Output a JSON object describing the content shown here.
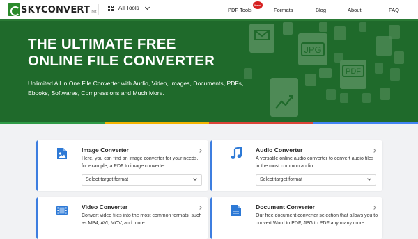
{
  "nav": {
    "logo_text": "SKYCONVERT",
    "logo_suffix": ".net",
    "all_tools": "All Tools",
    "links": [
      "PDF Tools",
      "Formats",
      "Blog",
      "About",
      "FAQ"
    ],
    "new_badge": "New!"
  },
  "hero": {
    "title_line1": "THE ULTIMATE FREE",
    "title_line2": "ONLINE FILE CONVERTER",
    "subtitle": "Unlimited All in One File Converter with Audio, Video, Images, Documents, PDFs, Ebooks, Softwares, Compressions and Much More.",
    "icon_labels": [
      "JPG",
      "PDF"
    ]
  },
  "cards": [
    {
      "title": "Image Converter",
      "desc": "Here, you can find an image converter for your needs, for example, a PDF to image converter.",
      "select_placeholder": "Select target format",
      "icon": "image-file-icon"
    },
    {
      "title": "Audio Converter",
      "desc": "A versatile online audio converter to convert audio files in the most common audio",
      "select_placeholder": "Select target format",
      "icon": "music-note-icon"
    },
    {
      "title": "Video Converter",
      "desc": "Convert video files into the most common formats, such as MP4, AVI, MOV, and more",
      "icon": "film-icon"
    },
    {
      "title": "Document Converter",
      "desc": "Our free document converter selection that allows you to convert Word to PDF, JPG to PDF any many more.",
      "icon": "document-icon"
    }
  ],
  "colors": {
    "hero_bg": "#1f6a2b",
    "accent_blue": "#3d7ee0",
    "badge_red": "#d62020"
  }
}
